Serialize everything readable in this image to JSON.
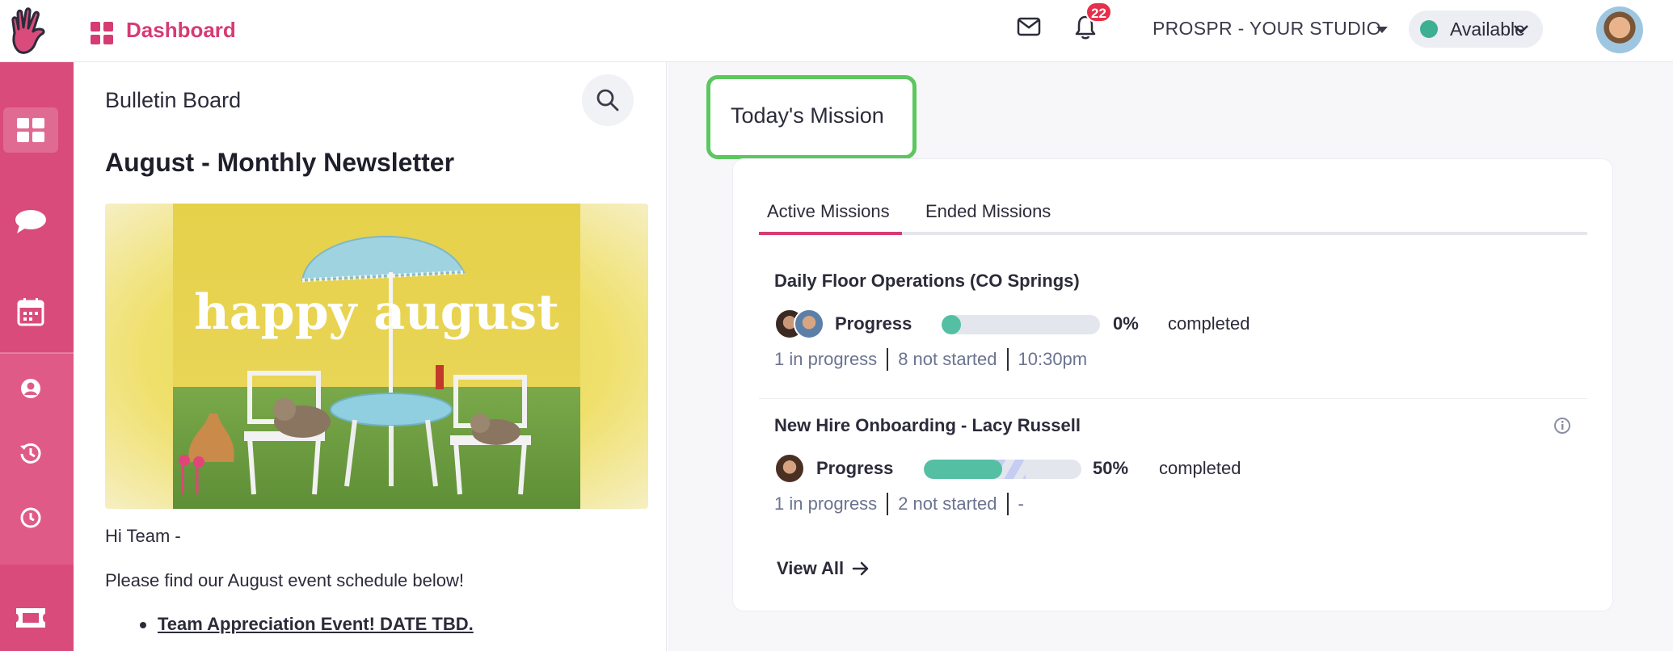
{
  "header": {
    "app_title": "Dashboard",
    "notification_count": "22",
    "studio_name": "PROSPR - YOUR STUDIO",
    "status_label": "Available"
  },
  "sidebar": {
    "items": [
      {
        "name": "dashboard",
        "icon": "grid-icon"
      },
      {
        "name": "messages",
        "icon": "chat-bubble-icon"
      },
      {
        "name": "calendar",
        "icon": "calendar-icon"
      },
      {
        "name": "profile",
        "icon": "user-circle-icon"
      },
      {
        "name": "history",
        "icon": "history-icon"
      },
      {
        "name": "time",
        "icon": "clock-icon"
      },
      {
        "name": "tickets",
        "icon": "ticket-icon"
      }
    ]
  },
  "bulletin": {
    "title": "Bulletin Board",
    "post_title": "August - Monthly Newsletter",
    "image_text": "happy august",
    "greeting": "Hi Team -",
    "intro": "Please find our August event schedule below!",
    "bullets": [
      "Team Appreciation Event! DATE TBD."
    ]
  },
  "missions": {
    "section_title": "Today's Mission",
    "tabs": [
      "Active Missions",
      "Ended Missions"
    ],
    "items": [
      {
        "title": "Daily Floor Operations (CO Springs)",
        "progress_label": "Progress",
        "progress": 0,
        "percent_text": "0%",
        "completed_label": "completed",
        "in_progress": "1 in progress",
        "not_started": "8 not started",
        "time": "10:30pm"
      },
      {
        "title": "New Hire Onboarding - Lacy Russell",
        "progress_label": "Progress",
        "progress": 0.5,
        "percent_text": "50%",
        "completed_label": "completed",
        "in_progress": "1 in progress",
        "not_started": "2 not started",
        "time": "-"
      }
    ],
    "view_all": "View All"
  },
  "colors": {
    "brand": "#d63b73",
    "sidebar": "#d94b7b",
    "available": "#3daf93",
    "progress": "#55bfa4",
    "highlight": "#5cc75f",
    "badge": "#e5304b"
  }
}
